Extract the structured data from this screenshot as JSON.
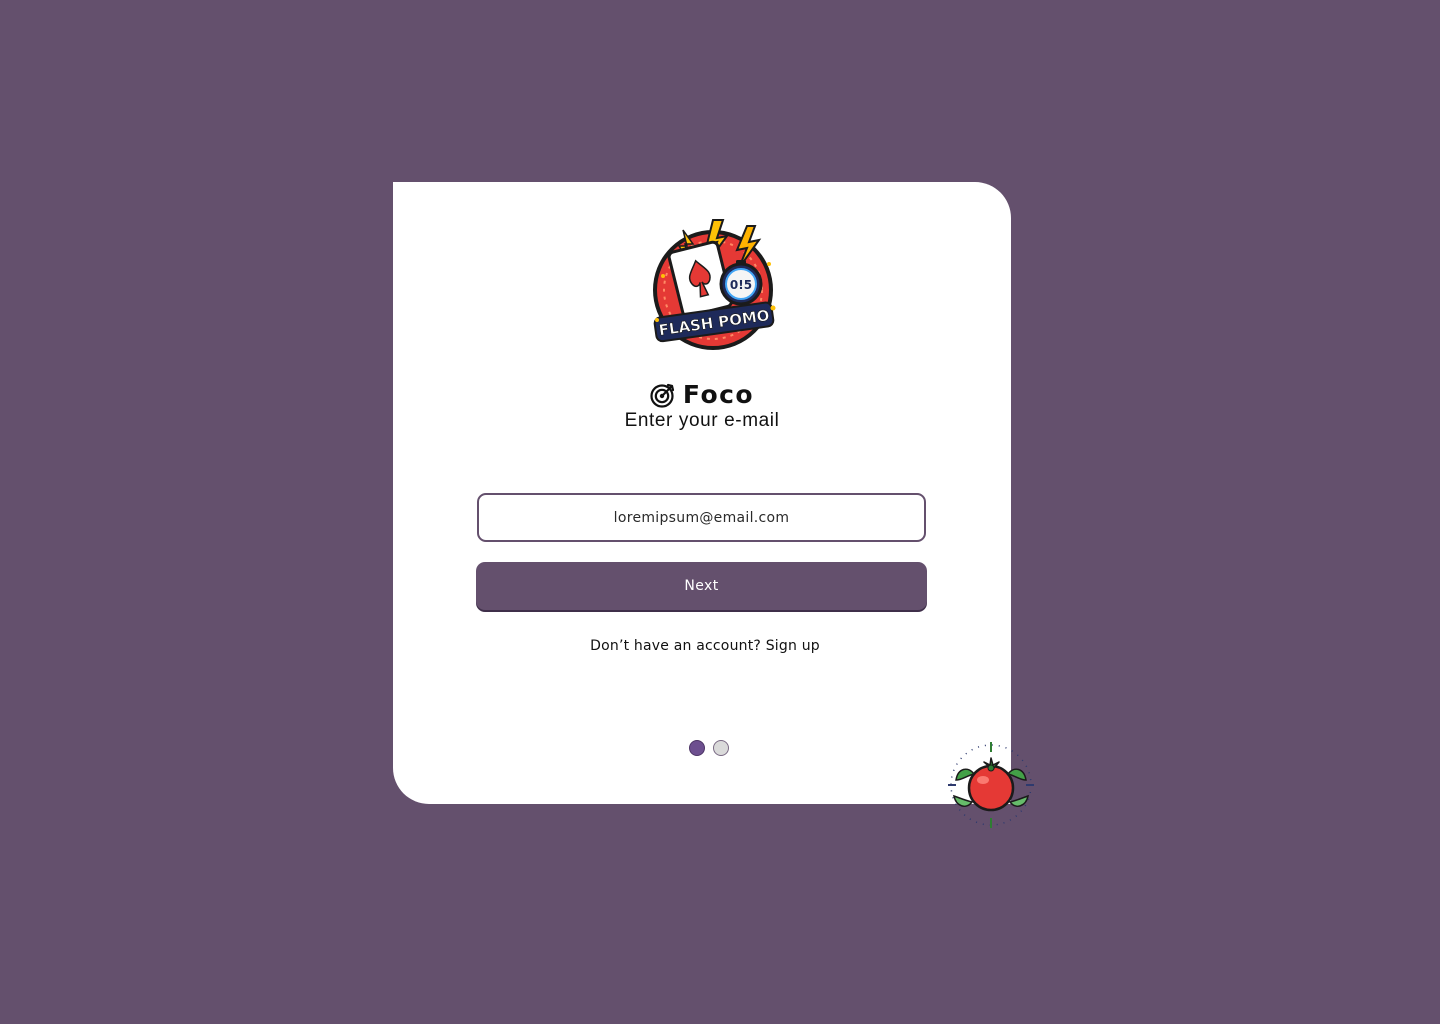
{
  "app": {
    "logo_text": "FLASH POMO",
    "logo_timer_text": "0!5",
    "brand_name": "Foco",
    "brand_icon": "target-icon"
  },
  "login": {
    "subtitle": "Enter your e-mail",
    "email_value": "loremipsum@email.com",
    "next_label": "Next",
    "signup_prompt": "Don’t have an account?",
    "signup_link": "Sign up"
  },
  "pagination": {
    "total_steps": 2,
    "current_step": 1
  },
  "colors": {
    "background": "#64506d",
    "card": "#ffffff",
    "accent": "#64506d",
    "dot_active": "#6d4f8f",
    "dot_inactive": "#dadada"
  },
  "decorations": {
    "corner_badge": "tomato-icon"
  }
}
